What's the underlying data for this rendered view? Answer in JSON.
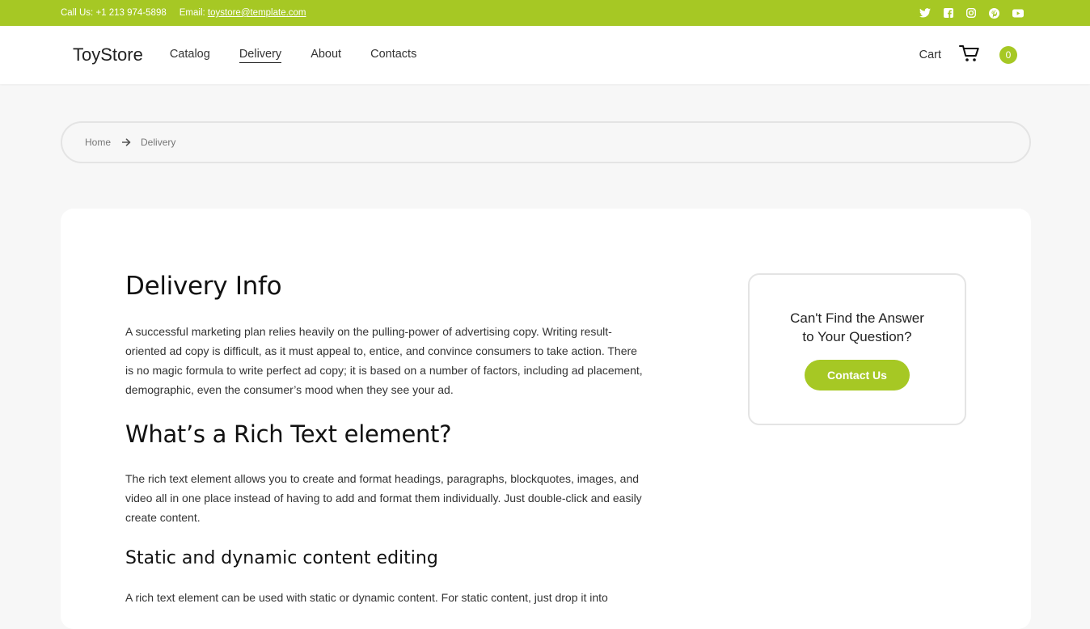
{
  "topbar": {
    "phone": "Call Us: +1 213 974-5898",
    "email_label": "Email:",
    "email": "toystore@template.com",
    "socials": [
      "twitter-icon",
      "facebook-icon",
      "instagram-icon",
      "pinterest-icon",
      "youtube-icon"
    ],
    "color": "#a6c824"
  },
  "nav": {
    "brand": "ToyStore",
    "items": [
      {
        "label": "Catalog"
      },
      {
        "label": "Delivery",
        "active": true
      },
      {
        "label": "About"
      },
      {
        "label": "Contacts"
      }
    ],
    "cart_label": "Cart",
    "cart_count": "0"
  },
  "breadcrumb": {
    "home": "Home",
    "current": "Delivery"
  },
  "content": {
    "h1": "Delivery Info",
    "p1": "A successful marketing plan relies heavily on the pulling-power of advertising copy. Writing result-oriented ad copy is difficult, as it must appeal to, entice, and convince consumers to take action. There is no magic formula to write perfect ad copy; it is based on a number of factors, including ad placement, demographic, even the consumer’s mood when they see your ad.",
    "h2": "What’s a Rich Text element?",
    "p2": "The rich text element allows you to create and format headings, paragraphs, blockquotes, images, and video all in one place instead of having to add and format them individually. Just double-click and easily create content.",
    "h3": "Static and dynamic content editing",
    "p3": "A rich text element can be used with static or dynamic content. For static content, just drop it into"
  },
  "sidebox": {
    "question_line1": "Can't Find the Answer",
    "question_line2": "to Your Question?",
    "button": "Contact Us"
  }
}
